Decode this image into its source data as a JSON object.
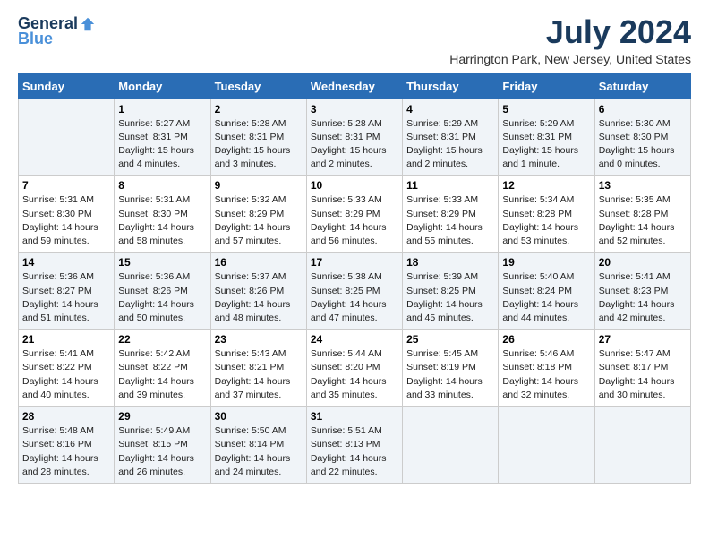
{
  "header": {
    "logo": {
      "general": "General",
      "blue": "Blue"
    },
    "title": "July 2024",
    "subtitle": "Harrington Park, New Jersey, United States"
  },
  "weekdays": [
    "Sunday",
    "Monday",
    "Tuesday",
    "Wednesday",
    "Thursday",
    "Friday",
    "Saturday"
  ],
  "weeks": [
    [
      {
        "day": "",
        "info": ""
      },
      {
        "day": "1",
        "info": "Sunrise: 5:27 AM\nSunset: 8:31 PM\nDaylight: 15 hours\nand 4 minutes."
      },
      {
        "day": "2",
        "info": "Sunrise: 5:28 AM\nSunset: 8:31 PM\nDaylight: 15 hours\nand 3 minutes."
      },
      {
        "day": "3",
        "info": "Sunrise: 5:28 AM\nSunset: 8:31 PM\nDaylight: 15 hours\nand 2 minutes."
      },
      {
        "day": "4",
        "info": "Sunrise: 5:29 AM\nSunset: 8:31 PM\nDaylight: 15 hours\nand 2 minutes."
      },
      {
        "day": "5",
        "info": "Sunrise: 5:29 AM\nSunset: 8:31 PM\nDaylight: 15 hours\nand 1 minute."
      },
      {
        "day": "6",
        "info": "Sunrise: 5:30 AM\nSunset: 8:30 PM\nDaylight: 15 hours\nand 0 minutes."
      }
    ],
    [
      {
        "day": "7",
        "info": "Sunrise: 5:31 AM\nSunset: 8:30 PM\nDaylight: 14 hours\nand 59 minutes."
      },
      {
        "day": "8",
        "info": "Sunrise: 5:31 AM\nSunset: 8:30 PM\nDaylight: 14 hours\nand 58 minutes."
      },
      {
        "day": "9",
        "info": "Sunrise: 5:32 AM\nSunset: 8:29 PM\nDaylight: 14 hours\nand 57 minutes."
      },
      {
        "day": "10",
        "info": "Sunrise: 5:33 AM\nSunset: 8:29 PM\nDaylight: 14 hours\nand 56 minutes."
      },
      {
        "day": "11",
        "info": "Sunrise: 5:33 AM\nSunset: 8:29 PM\nDaylight: 14 hours\nand 55 minutes."
      },
      {
        "day": "12",
        "info": "Sunrise: 5:34 AM\nSunset: 8:28 PM\nDaylight: 14 hours\nand 53 minutes."
      },
      {
        "day": "13",
        "info": "Sunrise: 5:35 AM\nSunset: 8:28 PM\nDaylight: 14 hours\nand 52 minutes."
      }
    ],
    [
      {
        "day": "14",
        "info": "Sunrise: 5:36 AM\nSunset: 8:27 PM\nDaylight: 14 hours\nand 51 minutes."
      },
      {
        "day": "15",
        "info": "Sunrise: 5:36 AM\nSunset: 8:26 PM\nDaylight: 14 hours\nand 50 minutes."
      },
      {
        "day": "16",
        "info": "Sunrise: 5:37 AM\nSunset: 8:26 PM\nDaylight: 14 hours\nand 48 minutes."
      },
      {
        "day": "17",
        "info": "Sunrise: 5:38 AM\nSunset: 8:25 PM\nDaylight: 14 hours\nand 47 minutes."
      },
      {
        "day": "18",
        "info": "Sunrise: 5:39 AM\nSunset: 8:25 PM\nDaylight: 14 hours\nand 45 minutes."
      },
      {
        "day": "19",
        "info": "Sunrise: 5:40 AM\nSunset: 8:24 PM\nDaylight: 14 hours\nand 44 minutes."
      },
      {
        "day": "20",
        "info": "Sunrise: 5:41 AM\nSunset: 8:23 PM\nDaylight: 14 hours\nand 42 minutes."
      }
    ],
    [
      {
        "day": "21",
        "info": "Sunrise: 5:41 AM\nSunset: 8:22 PM\nDaylight: 14 hours\nand 40 minutes."
      },
      {
        "day": "22",
        "info": "Sunrise: 5:42 AM\nSunset: 8:22 PM\nDaylight: 14 hours\nand 39 minutes."
      },
      {
        "day": "23",
        "info": "Sunrise: 5:43 AM\nSunset: 8:21 PM\nDaylight: 14 hours\nand 37 minutes."
      },
      {
        "day": "24",
        "info": "Sunrise: 5:44 AM\nSunset: 8:20 PM\nDaylight: 14 hours\nand 35 minutes."
      },
      {
        "day": "25",
        "info": "Sunrise: 5:45 AM\nSunset: 8:19 PM\nDaylight: 14 hours\nand 33 minutes."
      },
      {
        "day": "26",
        "info": "Sunrise: 5:46 AM\nSunset: 8:18 PM\nDaylight: 14 hours\nand 32 minutes."
      },
      {
        "day": "27",
        "info": "Sunrise: 5:47 AM\nSunset: 8:17 PM\nDaylight: 14 hours\nand 30 minutes."
      }
    ],
    [
      {
        "day": "28",
        "info": "Sunrise: 5:48 AM\nSunset: 8:16 PM\nDaylight: 14 hours\nand 28 minutes."
      },
      {
        "day": "29",
        "info": "Sunrise: 5:49 AM\nSunset: 8:15 PM\nDaylight: 14 hours\nand 26 minutes."
      },
      {
        "day": "30",
        "info": "Sunrise: 5:50 AM\nSunset: 8:14 PM\nDaylight: 14 hours\nand 24 minutes."
      },
      {
        "day": "31",
        "info": "Sunrise: 5:51 AM\nSunset: 8:13 PM\nDaylight: 14 hours\nand 22 minutes."
      },
      {
        "day": "",
        "info": ""
      },
      {
        "day": "",
        "info": ""
      },
      {
        "day": "",
        "info": ""
      }
    ]
  ]
}
